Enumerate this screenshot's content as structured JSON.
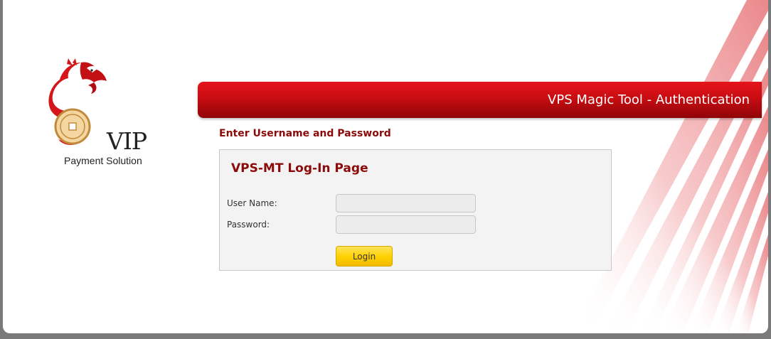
{
  "logo": {
    "brand": "VIP",
    "tagline": "Payment Solution"
  },
  "header": {
    "title": "VPS Magic Tool - Authentication"
  },
  "instructions": "Enter Username and Password",
  "login": {
    "title": "VPS-MT Log-In Page",
    "username_label": "User Name:",
    "username_value": "",
    "password_label": "Password:",
    "password_value": "",
    "submit_label": "Login"
  },
  "colors": {
    "accent": "#c80d12",
    "heading": "#8b0a0a",
    "button": "#ffd000"
  }
}
